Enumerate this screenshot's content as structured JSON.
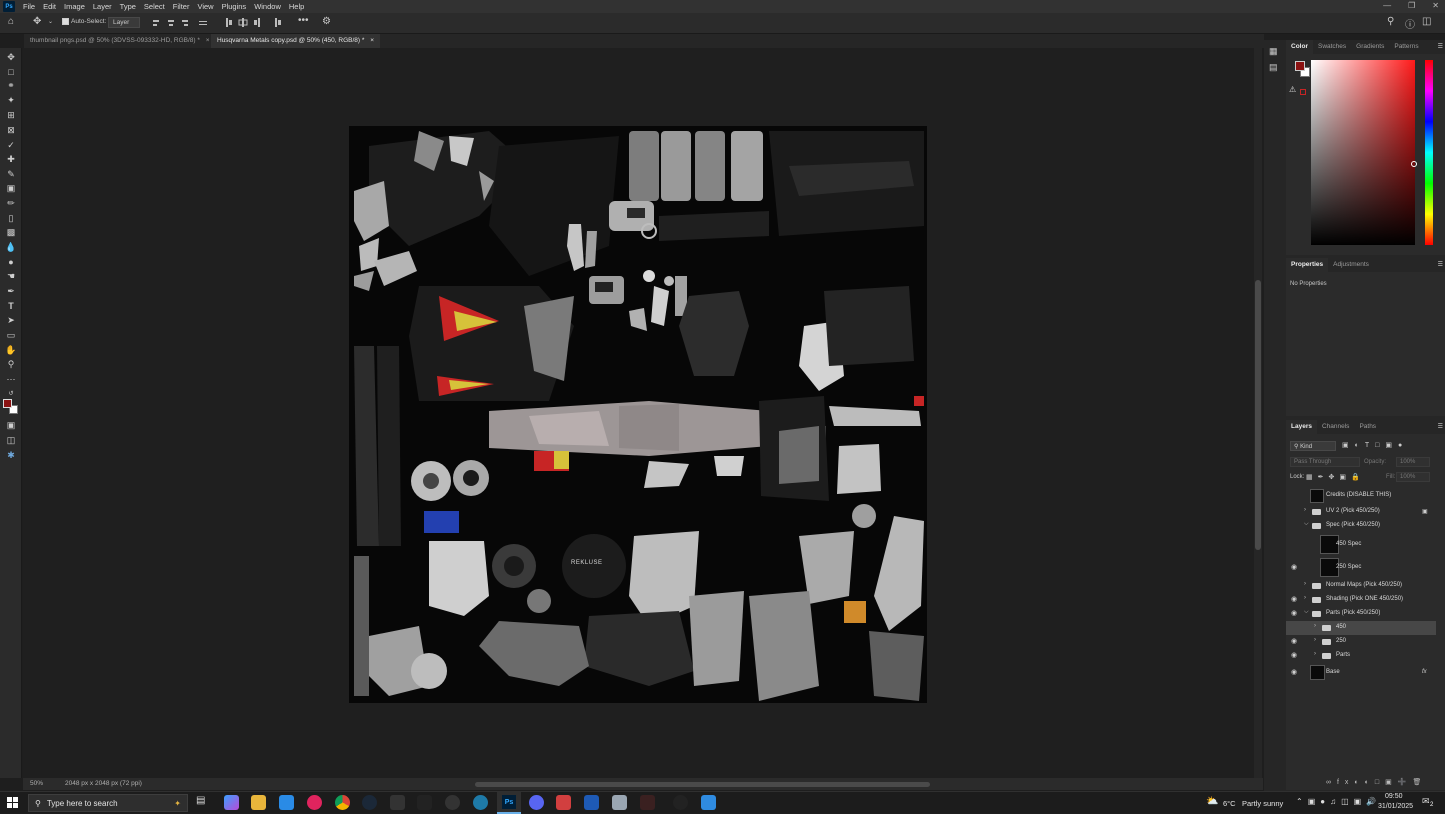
{
  "app": {
    "logo": "Ps",
    "menu": [
      "File",
      "Edit",
      "Image",
      "Layer",
      "Type",
      "Select",
      "Filter",
      "View",
      "Plugins",
      "Window",
      "Help"
    ]
  },
  "options_bar": {
    "auto_select_label": "Auto-Select:",
    "auto_select_target": "Layer",
    "auto_select_checked": true
  },
  "document_tabs": [
    {
      "label": "thumbnail pngs.psd @ 50% (3DVSS-093332-HD, RGB/8) *",
      "active": false
    },
    {
      "label": "Husqvarna Metals copy.psd @ 50% (450, RGB/8) *",
      "active": true
    }
  ],
  "status": {
    "zoom": "50%",
    "doc_size": "2048 px x 2048 px (72 ppi)"
  },
  "color_panel": {
    "tabs": [
      "Color",
      "Swatches",
      "Gradients",
      "Patterns"
    ],
    "active_tab": "Color",
    "foreground": "#8b1212",
    "background": "#ffffff",
    "hue_color": "#ff1a1a"
  },
  "properties_panel": {
    "tabs": [
      "Properties",
      "Adjustments"
    ],
    "active_tab": "Properties",
    "empty_text": "No Properties"
  },
  "layers_panel": {
    "tabs": [
      "Layers",
      "Channels",
      "Paths"
    ],
    "active_tab": "Layers",
    "filter_kind": "Kind",
    "blend_mode": "Pass Through",
    "opacity_label": "Opacity:",
    "opacity_value": "100%",
    "lock_label": "Lock:",
    "fill_label": "Fill:",
    "fill_value": "100%",
    "layers": [
      {
        "name": "Credits (DISABLE THIS)",
        "type": "image",
        "visible": false,
        "indent": 0,
        "expanded": false,
        "selected": false,
        "locked": false
      },
      {
        "name": "UV 2 (Pick 450/250)",
        "type": "group",
        "visible": false,
        "indent": 0,
        "expanded": false,
        "selected": false,
        "locked": true
      },
      {
        "name": "Spec (Pick 450/250)",
        "type": "group",
        "visible": false,
        "indent": 0,
        "expanded": true,
        "selected": false,
        "locked": false
      },
      {
        "name": "450 Spec",
        "type": "image",
        "visible": false,
        "indent": 1,
        "expanded": false,
        "selected": false,
        "locked": false
      },
      {
        "name": "250 Spec",
        "type": "image",
        "visible": true,
        "indent": 1,
        "expanded": false,
        "selected": false,
        "locked": false
      },
      {
        "name": "Normal Maps (Pick 450/250)",
        "type": "group",
        "visible": false,
        "indent": 0,
        "expanded": false,
        "selected": false,
        "locked": false
      },
      {
        "name": "Shading (Pick ONE 450/250)",
        "type": "group",
        "visible": true,
        "indent": 0,
        "expanded": false,
        "selected": false,
        "locked": false
      },
      {
        "name": "Parts (Pick 450/250)",
        "type": "group",
        "visible": true,
        "indent": 0,
        "expanded": true,
        "selected": false,
        "locked": false
      },
      {
        "name": "450",
        "type": "group",
        "visible": false,
        "indent": 1,
        "expanded": false,
        "selected": true,
        "locked": false
      },
      {
        "name": "250",
        "type": "group",
        "visible": true,
        "indent": 1,
        "expanded": false,
        "selected": false,
        "locked": false
      },
      {
        "name": "Parts",
        "type": "group",
        "visible": true,
        "indent": 1,
        "expanded": false,
        "selected": false,
        "locked": false
      },
      {
        "name": "Base",
        "type": "image",
        "visible": true,
        "indent": 0,
        "expanded": false,
        "selected": false,
        "locked": false,
        "fx": "fx"
      }
    ]
  },
  "taskbar": {
    "search_placeholder": "Type here to search",
    "weather_temp": "6°C",
    "weather_text": "Partly sunny",
    "time": "09:50",
    "date": "31/01/2025",
    "notification_count": "2"
  },
  "canvas_text": {
    "logo_text": "REKLUSE"
  }
}
